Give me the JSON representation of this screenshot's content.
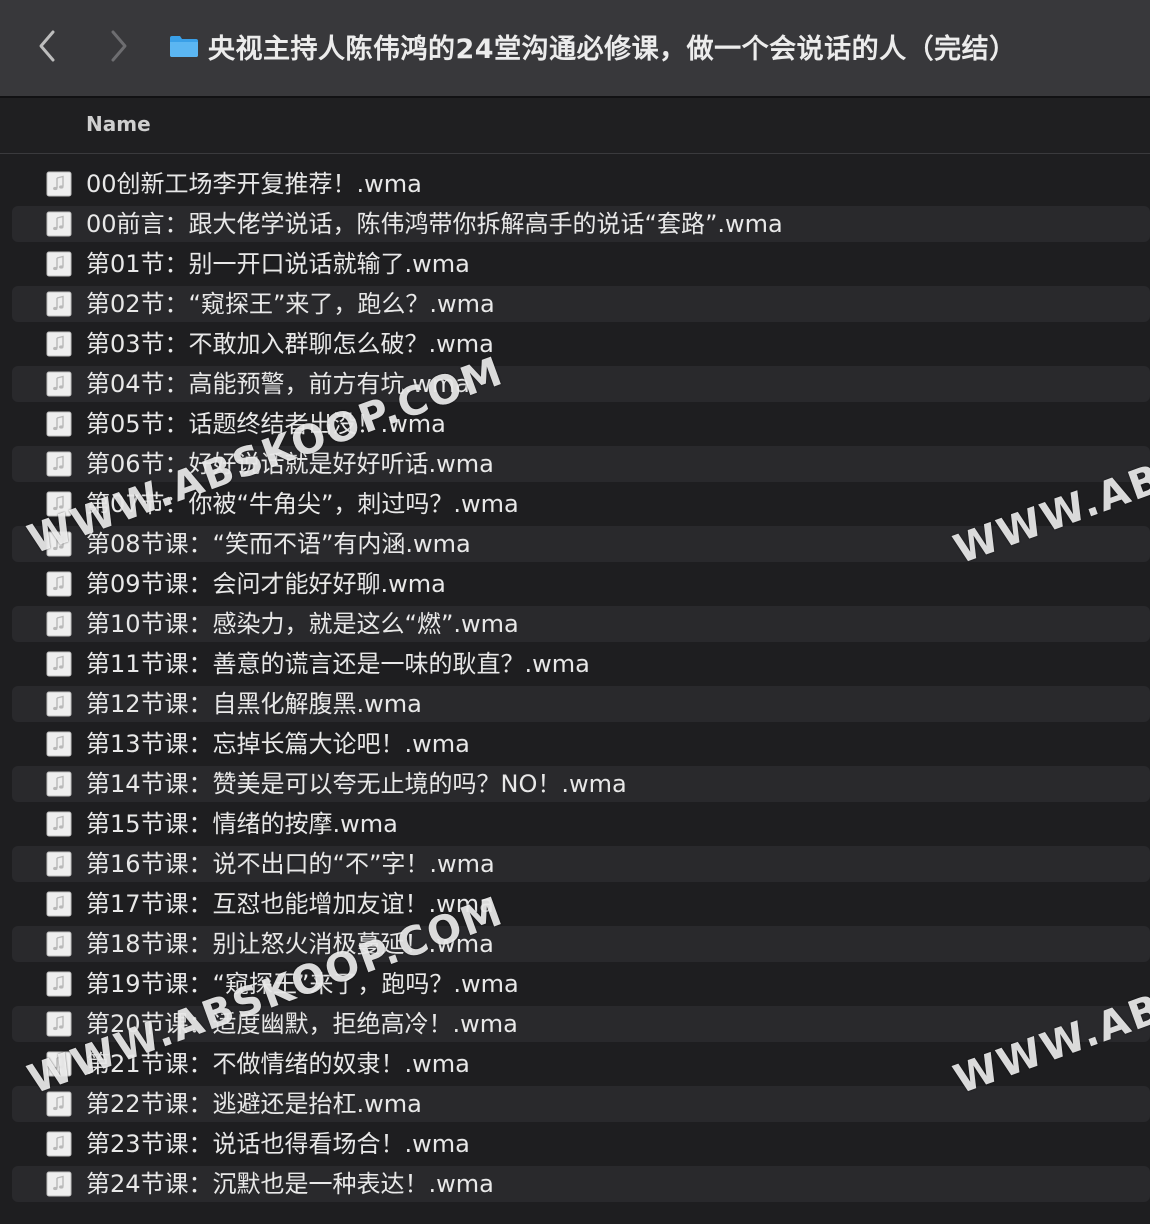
{
  "window": {
    "title": "央视主持人陈伟鸿的24堂沟通必修课，做一个会说话的人（完结）"
  },
  "nav": {
    "back_icon": "chevron-left-icon",
    "forward_icon": "chevron-right-icon"
  },
  "header": {
    "name_column": "Name"
  },
  "files": [
    {
      "name": "00创新工场李开复推荐！.wma"
    },
    {
      "name": "00前言：跟大佬学说话，陈伟鸿带你拆解高手的说话“套路”.wma"
    },
    {
      "name": "第01节：别一开口说话就输了.wma"
    },
    {
      "name": "第02节：“窥探王”来了，跑么？.wma"
    },
    {
      "name": "第03节：不敢加入群聊怎么破？.wma"
    },
    {
      "name": "第04节：高能预警，前方有坑.wma"
    },
    {
      "name": "第05节：话题终结者出没！.wma"
    },
    {
      "name": "第06节：好好说话就是好好听话.wma"
    },
    {
      "name": "第07节：你被“牛角尖”，刺过吗？.wma"
    },
    {
      "name": "第08节课：“笑而不语”有内涵.wma"
    },
    {
      "name": "第09节课：会问才能好好聊.wma"
    },
    {
      "name": "第10节课：感染力，就是这么“燃”.wma"
    },
    {
      "name": "第11节课：善意的谎言还是一味的耿直？.wma"
    },
    {
      "name": "第12节课：自黑化解腹黑.wma"
    },
    {
      "name": "第13节课：忘掉长篇大论吧！.wma"
    },
    {
      "name": "第14节课：赞美是可以夸无止境的吗？NO！.wma"
    },
    {
      "name": "第15节课：情绪的按摩.wma"
    },
    {
      "name": "第16节课：说不出口的“不”字！.wma"
    },
    {
      "name": "第17节课：互怼也能增加友谊！.wma"
    },
    {
      "name": "第18节课：别让怒火消极蔓延！.wma"
    },
    {
      "name": "第19节课：“窥探王”来了，跑吗？.wma"
    },
    {
      "name": "第20节课：适度幽默，拒绝高冷！.wma"
    },
    {
      "name": "第21节课：不做情绪的奴隶！.wma"
    },
    {
      "name": "第22节课：逃避还是抬杠.wma"
    },
    {
      "name": "第23节课：说话也得看场合！.wma"
    },
    {
      "name": "第24节课：沉默也是一种表达！.wma"
    }
  ],
  "watermarks": {
    "main": "WWW.ABSKOOP.COM",
    "main2": "WWW.ABSKOOP.COM",
    "side": "WWW.ABS",
    "side2": "WWW.ABS"
  },
  "colors": {
    "titlebar": "#38383b",
    "background": "#1e1e20",
    "stripe": "#29292c",
    "folder": "#3aa0e8"
  }
}
